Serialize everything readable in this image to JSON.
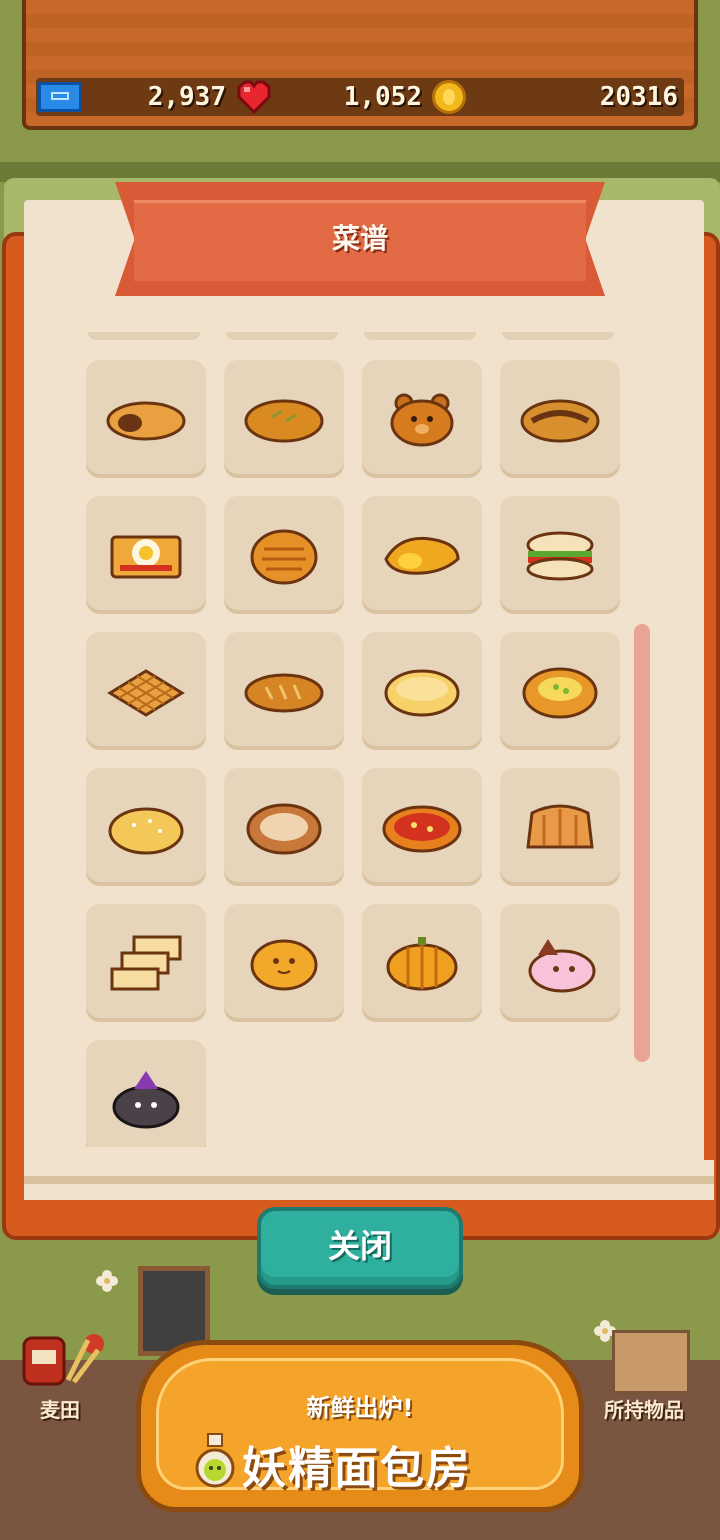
{
  "resources": {
    "tickets": "2,937",
    "hearts": "1,052",
    "coins": "20316"
  },
  "recipe_book": {
    "title": "菜谱",
    "items": [
      {
        "icon": "cream-roll-icon"
      },
      {
        "icon": "herb-bread-icon"
      },
      {
        "icon": "bear-bread-icon"
      },
      {
        "icon": "chocolate-pastry-icon"
      },
      {
        "icon": "egg-toast-icon"
      },
      {
        "icon": "round-pie-icon"
      },
      {
        "icon": "croissant-icon"
      },
      {
        "icon": "sandwich-icon"
      },
      {
        "icon": "waffle-icon"
      },
      {
        "icon": "baguette-icon"
      },
      {
        "icon": "melon-bread-icon"
      },
      {
        "icon": "corn-bun-icon"
      },
      {
        "icon": "sugar-bun-icon"
      },
      {
        "icon": "round-loaf-icon"
      },
      {
        "icon": "tomato-bread-icon"
      },
      {
        "icon": "bundt-cake-icon"
      },
      {
        "icon": "toast-slices-icon"
      },
      {
        "icon": "smiling-bun-icon"
      },
      {
        "icon": "pumpkin-bread-icon"
      },
      {
        "icon": "pink-fairy-bun-icon"
      },
      {
        "icon": "witch-cat-bun-icon"
      }
    ]
  },
  "close_button": {
    "label": "关闭"
  },
  "bottom_nav": {
    "left_label": "麦田",
    "right_label": "所持物品"
  },
  "logo": {
    "subtitle": "新鲜出炉!",
    "title": "妖精面包房"
  }
}
